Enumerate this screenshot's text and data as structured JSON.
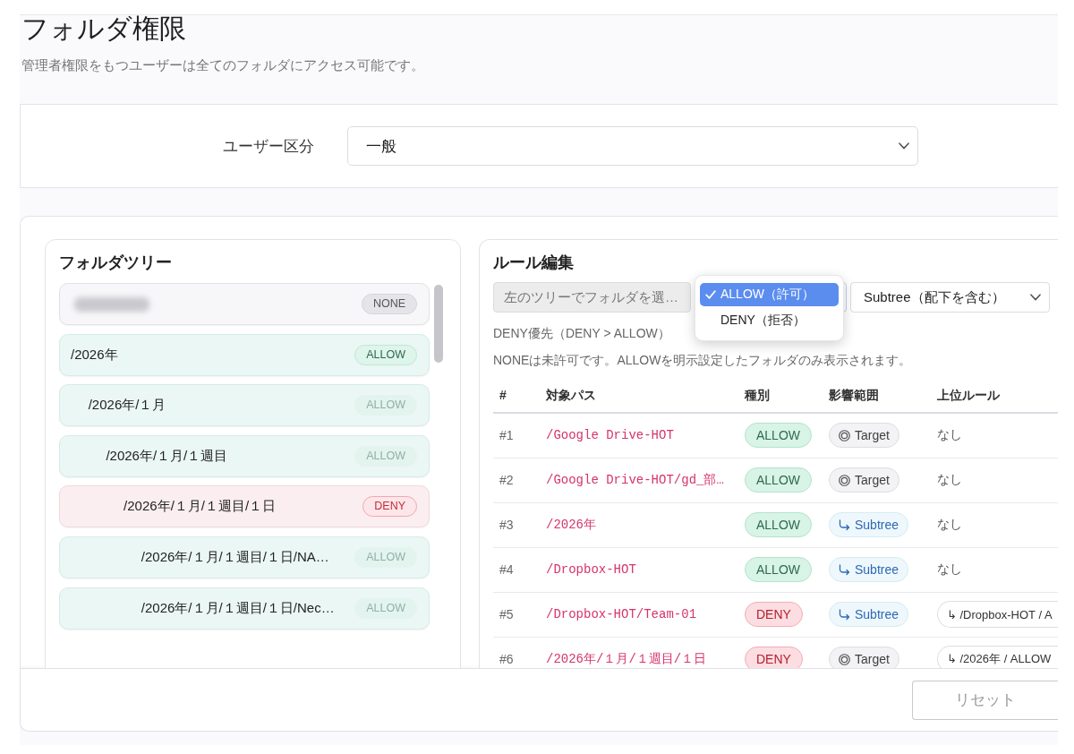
{
  "page": {
    "title": "フォルダ権限",
    "subtitle": "管理者権限をもつユーザーは全てのフォルダにアクセス可能です。"
  },
  "user_type": {
    "label": "ユーザー区分",
    "value": "一般"
  },
  "folder_tree": {
    "title": "フォルダツリー",
    "items": [
      {
        "redacted": true,
        "kind": "none",
        "badge": "NONE",
        "inherited": false
      },
      {
        "label": "/2026年",
        "kind": "allow",
        "badge": "ALLOW",
        "inherited": false,
        "children": [
          {
            "label": "/2026年/１月",
            "kind": "allow",
            "badge": "ALLOW",
            "inherited": true,
            "children": [
              {
                "label": "/2026年/１月/１週目",
                "kind": "allow",
                "badge": "ALLOW",
                "inherited": true,
                "children": [
                  {
                    "label": "/2026年/１月/１週目/１日",
                    "kind": "deny",
                    "badge": "DENY",
                    "inherited": false,
                    "children": [
                      {
                        "label": "/2026年/１月/１週目/１日/NA…",
                        "kind": "allow",
                        "badge": "ALLOW",
                        "inherited": true
                      },
                      {
                        "label": "/2026年/１月/１週目/１日/Nec…",
                        "kind": "allow",
                        "badge": "ALLOW",
                        "inherited": true
                      }
                    ]
                  }
                ]
              }
            ]
          }
        ]
      }
    ]
  },
  "rule_editor": {
    "title": "ルール編集",
    "folder_field": {
      "placeholder": "左のツリーでフォルダを選…"
    },
    "type_select": {
      "expanded": true,
      "options": [
        {
          "label": "ALLOW（許可）",
          "selected": true
        },
        {
          "label": "DENY（拒否）",
          "selected": false
        }
      ]
    },
    "scope_select": {
      "value": "Subtree（配下を含む）"
    },
    "notes": [
      "DENY優先（DENY > ALLOW）",
      "NONEは未許可です。ALLOWを明示設定したフォルダのみ表示されます。"
    ],
    "table": {
      "columns": [
        "#",
        "対象パス",
        "種別",
        "影響範囲",
        "上位ルール"
      ],
      "rows": [
        {
          "number": "#1",
          "path": "/Google Drive-HOT",
          "type": {
            "kind": "allow",
            "label": "ALLOW"
          },
          "scope": {
            "kind": "target",
            "label": "Target"
          },
          "parent": {
            "kind": "none",
            "label": "なし"
          }
        },
        {
          "number": "#2",
          "path": "/Google Drive-HOT/gd_部…",
          "type": {
            "kind": "allow",
            "label": "ALLOW"
          },
          "scope": {
            "kind": "target",
            "label": "Target"
          },
          "parent": {
            "kind": "none",
            "label": "なし"
          }
        },
        {
          "number": "#3",
          "path": "/2026年",
          "type": {
            "kind": "allow",
            "label": "ALLOW"
          },
          "scope": {
            "kind": "subtree",
            "label": "Subtree"
          },
          "parent": {
            "kind": "none",
            "label": "なし"
          }
        },
        {
          "number": "#4",
          "path": "/Dropbox-HOT",
          "type": {
            "kind": "allow",
            "label": "ALLOW"
          },
          "scope": {
            "kind": "subtree",
            "label": "Subtree"
          },
          "parent": {
            "kind": "none",
            "label": "なし"
          }
        },
        {
          "number": "#5",
          "path": "/Dropbox-HOT/Team-01",
          "type": {
            "kind": "deny",
            "label": "DENY"
          },
          "scope": {
            "kind": "subtree",
            "label": "Subtree"
          },
          "parent": {
            "kind": "rule",
            "label": "↳ /Dropbox-HOT / A"
          }
        },
        {
          "number": "#6",
          "path": "/2026年/１月/１週目/１日",
          "type": {
            "kind": "deny",
            "label": "DENY"
          },
          "scope": {
            "kind": "target",
            "label": "Target"
          },
          "parent": {
            "kind": "rule",
            "label": "↳ /2026年 / ALLOW"
          }
        }
      ]
    }
  },
  "footer": {
    "reset_button": {
      "label": "リセット",
      "disabled": true
    }
  }
}
